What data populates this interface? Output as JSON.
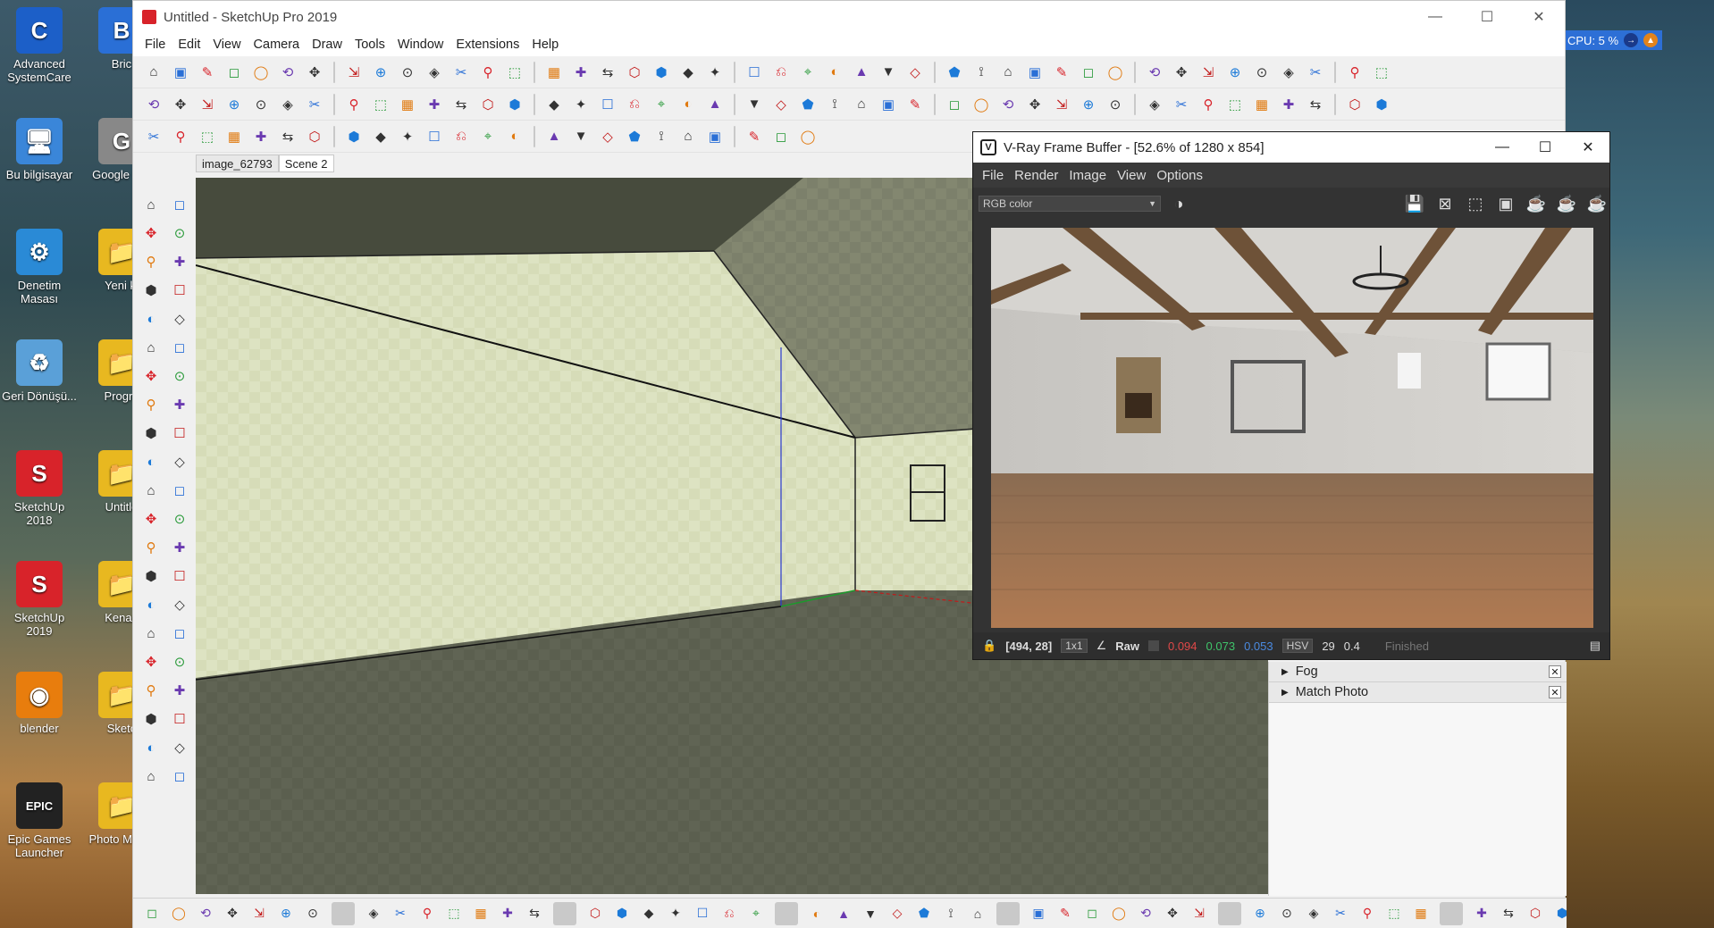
{
  "desktop": {
    "icons": [
      {
        "label": "Advanced SystemCare",
        "glyph": "C",
        "color": "#1c5fc8"
      },
      {
        "label": "Bu bilgisayar",
        "glyph": "🖥",
        "color": "#3a86d9"
      },
      {
        "label": "Denetim Masası",
        "glyph": "⚙",
        "color": "#2a8ad6"
      },
      {
        "label": "Geri Dönüşü...",
        "glyph": "♻",
        "color": "#5aa0d8"
      },
      {
        "label": "SketchUp 2018",
        "glyph": "S",
        "color": "#d8232a"
      },
      {
        "label": "SketchUp 2019",
        "glyph": "S",
        "color": "#d8232a"
      },
      {
        "label": "blender",
        "glyph": "◉",
        "color": "#e87d0d"
      },
      {
        "label": "Epic Games Launcher",
        "glyph": "EPIC",
        "color": "#222222"
      }
    ],
    "icons2": [
      {
        "label": "Bric",
        "glyph": "B",
        "color": "#2a6fd6"
      },
      {
        "label": "Google Pro",
        "glyph": "G",
        "color": "#888888"
      },
      {
        "label": "Yeni kl",
        "glyph": "📁",
        "color": "#e8b820"
      },
      {
        "label": "Progra",
        "glyph": "📁",
        "color": "#e8b820"
      },
      {
        "label": "Untitle",
        "glyph": "📁",
        "color": "#e8b820"
      },
      {
        "label": "Kenan",
        "glyph": "📁",
        "color": "#e8b820"
      },
      {
        "label": "Sketc",
        "glyph": "📁",
        "color": "#e8b820"
      },
      {
        "label": "Photo M Der",
        "glyph": "📁",
        "color": "#e8b820"
      }
    ],
    "cpu_widget": "CPU: 5 %"
  },
  "sketchup": {
    "title": "Untitled - SketchUp Pro 2019",
    "menu": [
      "File",
      "Edit",
      "View",
      "Camera",
      "Draw",
      "Tools",
      "Window",
      "Extensions",
      "Help"
    ],
    "scene_tabs": [
      "image_62793",
      "Scene 2"
    ],
    "window_controls": {
      "minimize": "—",
      "maximize": "☐",
      "close": "✕"
    }
  },
  "tray": {
    "items": [
      {
        "label": "Fog"
      },
      {
        "label": "Match Photo"
      }
    ]
  },
  "vray": {
    "title": "V-Ray Frame Buffer - [52.6% of 1280 x 854]",
    "menu": [
      "File",
      "Render",
      "Image",
      "View",
      "Options"
    ],
    "channel": "RGB color",
    "status": {
      "coords": "[494, 28]",
      "zoom": "1x1",
      "raw": "Raw",
      "r": "0.094",
      "g": "0.073",
      "b": "0.053",
      "mode": "HSV",
      "v1": "29",
      "v2": "0.4",
      "state": "Finished"
    }
  }
}
